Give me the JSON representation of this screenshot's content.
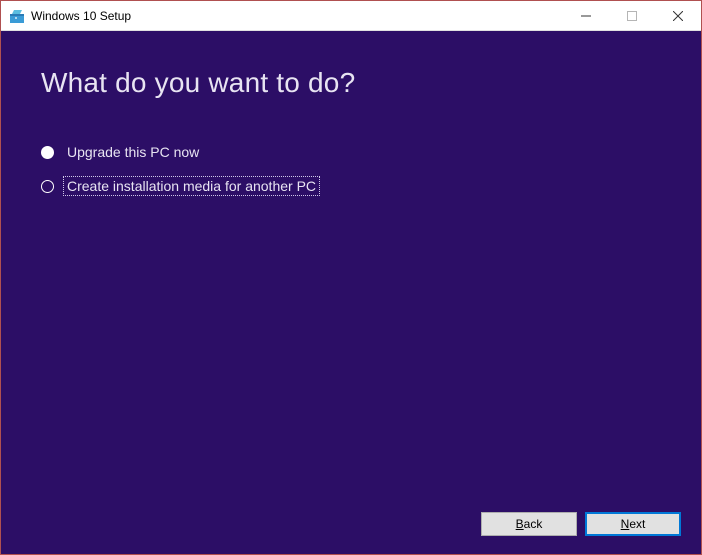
{
  "window": {
    "title": "Windows 10 Setup"
  },
  "main": {
    "heading": "What do you want to do?",
    "options": [
      {
        "label": "Upgrade this PC now",
        "selected": false
      },
      {
        "label": "Create installation media for another PC",
        "selected": true,
        "focused": true
      }
    ]
  },
  "footer": {
    "back": {
      "label": "Back",
      "accel": "B"
    },
    "next": {
      "label": "Next",
      "accel": "N"
    }
  }
}
